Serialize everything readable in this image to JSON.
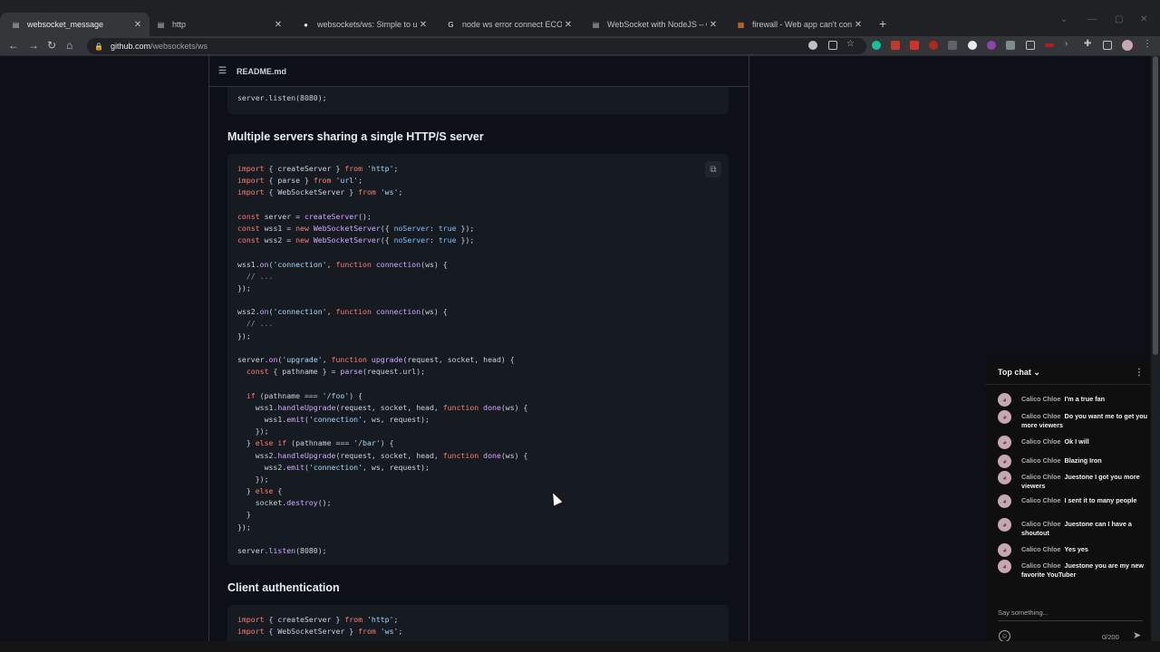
{
  "browser": {
    "tabs": [
      {
        "title": "websocket_message",
        "icon": "page-icon"
      },
      {
        "title": "http",
        "icon": "page-icon"
      },
      {
        "title": "websockets/ws: Simple to use, b",
        "icon": "github-icon"
      },
      {
        "title": "node ws error connect ECONNR",
        "icon": "google-icon"
      },
      {
        "title": "WebSocket with NodeJS – Quick",
        "icon": "page-icon"
      },
      {
        "title": "firewall - Web app can't connect",
        "icon": "stackoverflow-icon"
      }
    ],
    "url_host": "github.com",
    "url_path": "/websockets/ws"
  },
  "readme": {
    "file_name": "README.md",
    "top_code_last_line": "server.listen(8080);",
    "section1_title": "Multiple servers sharing a single HTTP/S server",
    "section2_title": "Client authentication",
    "code1": [
      "import { createServer } from 'http';",
      "import { parse } from 'url';",
      "import { WebSocketServer } from 'ws';",
      "",
      "const server = createServer();",
      "const wss1 = new WebSocketServer({ noServer: true });",
      "const wss2 = new WebSocketServer({ noServer: true });",
      "",
      "wss1.on('connection', function connection(ws) {",
      "  // ...",
      "});",
      "",
      "wss2.on('connection', function connection(ws) {",
      "  // ...",
      "});",
      "",
      "server.on('upgrade', function upgrade(request, socket, head) {",
      "  const { pathname } = parse(request.url);",
      "",
      "  if (pathname === '/foo') {",
      "    wss1.handleUpgrade(request, socket, head, function done(ws) {",
      "      wss1.emit('connection', ws, request);",
      "    });",
      "  } else if (pathname === '/bar') {",
      "    wss2.handleUpgrade(request, socket, head, function done(ws) {",
      "      wss2.emit('connection', ws, request);",
      "    });",
      "  } else {",
      "    socket.destroy();",
      "  }",
      "});",
      "",
      "server.listen(8080);"
    ],
    "code2": [
      "import { createServer } from 'http';",
      "import { WebSocketServer } from 'ws';"
    ]
  },
  "chat": {
    "header": "Top chat",
    "messages": [
      {
        "author": "Calico Chloe",
        "text": "I'm a true fan"
      },
      {
        "author": "Calico Chloe",
        "text": "Do you want me to get you more viewers"
      },
      {
        "author": "Calico Chloe",
        "text": "Ok I will"
      },
      {
        "author": "Calico Chloe",
        "text": "Blazing Iron"
      },
      {
        "author": "Calico Chloe",
        "text": "Juestone I got you more viewers"
      },
      {
        "author": "Calico Chloe",
        "text": "I sent it to many people"
      },
      {
        "author": "Calico Chloe",
        "text": "Juestone can I have a shoutout"
      },
      {
        "author": "Calico Chloe",
        "text": "Yes yes"
      },
      {
        "author": "Calico Chloe",
        "text": "Juestone you are my new favorite YouTuber"
      }
    ],
    "input_placeholder": "Say something...",
    "char_count": "0/200"
  },
  "colors": {
    "page_bg": "#0d1117",
    "code_bg": "#161b22",
    "keyword": "#ff7b72",
    "function": "#d2a8ff",
    "string": "#a5d6ff",
    "constant": "#79c0ff"
  }
}
